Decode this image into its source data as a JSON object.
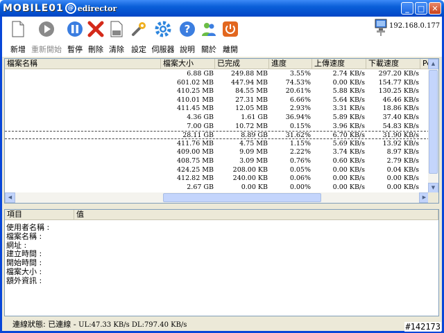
{
  "window": {
    "title": "edirector",
    "brand": "MOBILE01"
  },
  "toolbar": {
    "buttons": [
      {
        "label": "新增",
        "icon": "new-file-icon",
        "enabled": true
      },
      {
        "label": "重新開始",
        "icon": "restart-icon",
        "enabled": false
      },
      {
        "label": "暫停",
        "icon": "pause-icon",
        "enabled": true
      },
      {
        "label": "刪除",
        "icon": "delete-icon",
        "enabled": true
      },
      {
        "label": "清除",
        "icon": "clear-icon",
        "enabled": true
      },
      {
        "label": "設定",
        "icon": "wrench-icon",
        "enabled": true
      },
      {
        "label": "伺服器",
        "icon": "gear-icon",
        "enabled": true
      },
      {
        "label": "說明",
        "icon": "help-icon",
        "enabled": true
      },
      {
        "label": "關於",
        "icon": "users-icon",
        "enabled": true
      },
      {
        "label": "離開",
        "icon": "power-icon",
        "enabled": true
      }
    ],
    "ip": "192.168.0.177"
  },
  "file_list": {
    "columns": [
      "檔案名稱",
      "檔案大小",
      "已完成",
      "進度",
      "上傳速度",
      "下載速度",
      "Pe"
    ],
    "rows": [
      [
        "",
        "6.88 GB",
        "249.88 MB",
        "3.55%",
        "2.74 KB/s",
        "297.20 KB/s"
      ],
      [
        "",
        "601.02 MB",
        "447.94 MB",
        "74.53%",
        "0.00 KB/s",
        "154.77 KB/s"
      ],
      [
        "",
        "410.25 MB",
        "84.55 MB",
        "20.61%",
        "5.88 KB/s",
        "130.25 KB/s"
      ],
      [
        "",
        "410.01 MB",
        "27.31 MB",
        "6.66%",
        "5.64 KB/s",
        "46.46 KB/s"
      ],
      [
        "",
        "411.45 MB",
        "12.05 MB",
        "2.93%",
        "3.31 KB/s",
        "18.86 KB/s"
      ],
      [
        "",
        "4.36 GB",
        "1.61 GB",
        "36.94%",
        "5.89 KB/s",
        "37.40 KB/s"
      ],
      [
        "",
        "7.00 GB",
        "10.72 MB",
        "0.15%",
        "3.96 KB/s",
        "54.83 KB/s"
      ],
      [
        "",
        "28.11 GB",
        "8.89 GB",
        "31.62%",
        "6.70 KB/s",
        "31.90 KB/s"
      ],
      [
        "",
        "411.76 MB",
        "4.75 MB",
        "1.15%",
        "5.69 KB/s",
        "13.92 KB/s"
      ],
      [
        "",
        "409.00 MB",
        "9.09 MB",
        "2.22%",
        "3.74 KB/s",
        "8.97 KB/s"
      ],
      [
        "",
        "408.75 MB",
        "3.09 MB",
        "0.76%",
        "0.60 KB/s",
        "2.79 KB/s"
      ],
      [
        "",
        "424.25 MB",
        "208.00 KB",
        "0.05%",
        "0.00 KB/s",
        "0.04 KB/s"
      ],
      [
        "",
        "412.82 MB",
        "240.00 KB",
        "0.06%",
        "0.00 KB/s",
        "0.00 KB/s"
      ],
      [
        "",
        "2.67 GB",
        "0.00 KB",
        "0.00%",
        "0.00 KB/s",
        "0.00 KB/s"
      ]
    ]
  },
  "detail": {
    "columns": [
      "項目",
      "值"
    ],
    "items": [
      "使用者名稱 :",
      "檔案名稱 :",
      "網址 :",
      "建立時間 :",
      "開始時間 :",
      "檔案大小 :",
      "額外資訊 :"
    ]
  },
  "status": {
    "label": "連線狀態: 已連線 - ",
    "speeds": "UL:47.33 KB/s  DL:797.40 KB/s"
  },
  "watermark": "#142173"
}
